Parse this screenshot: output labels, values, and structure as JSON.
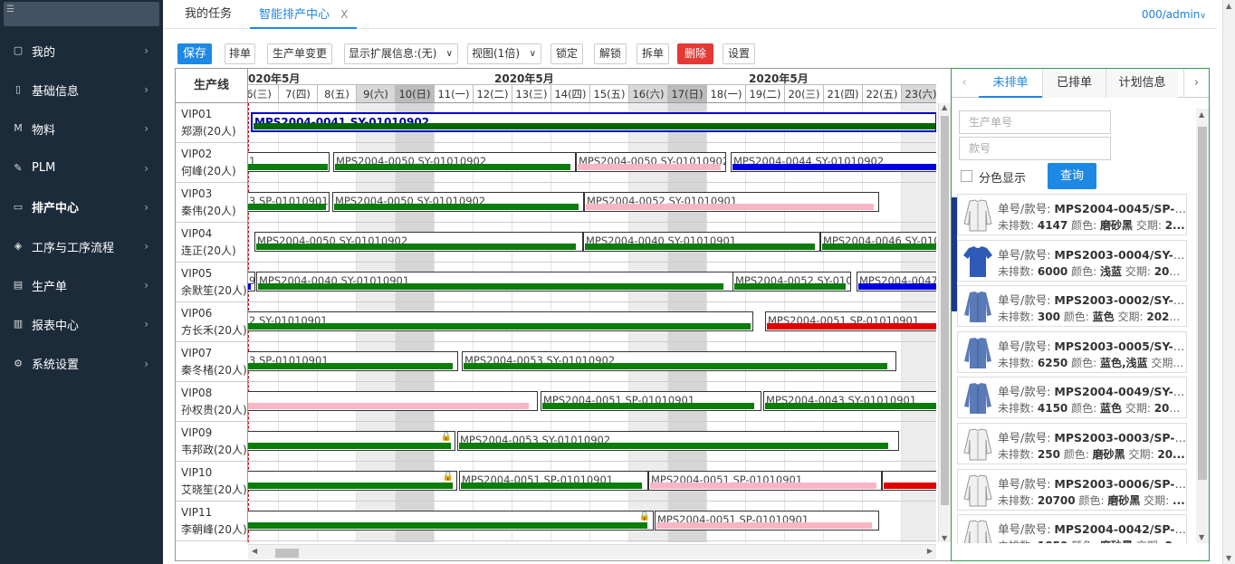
{
  "sidebar": {
    "items": [
      {
        "icon": "home-icon",
        "label": "我的"
      },
      {
        "icon": "document-icon",
        "label": "基础信息"
      },
      {
        "icon": "m-icon",
        "label": "物料"
      },
      {
        "icon": "pen-icon",
        "label": "PLM"
      },
      {
        "icon": "schedule-icon",
        "label": "排产中心"
      },
      {
        "icon": "tag-icon",
        "label": "工序与工序流程"
      },
      {
        "icon": "file-icon",
        "label": "生产单"
      },
      {
        "icon": "chart-icon",
        "label": "报表中心"
      },
      {
        "icon": "gear-icon",
        "label": "系统设置"
      }
    ]
  },
  "header": {
    "tabs": [
      {
        "label": "我的任务"
      },
      {
        "label": "智能排产中心",
        "close": "X"
      }
    ],
    "user": "000/admin"
  },
  "toolbar": {
    "save": "保存",
    "schedule": "排单",
    "change": "生产单变更",
    "ext_info": "显示扩展信息:(无)",
    "view": "视图(1倍)",
    "lock": "锁定",
    "unlock": "解锁",
    "split": "拆单",
    "delete": "删除",
    "settings": "设置"
  },
  "gantt": {
    "line_header": "生产线",
    "months": [
      "020年5月",
      "2020年5月",
      "2020年5月"
    ],
    "days": [
      "6(三)",
      "7(四)",
      "8(五)",
      "9(六)",
      "10(日)",
      "11(一)",
      "12(二)",
      "13(三)",
      "14(四)",
      "15(五)",
      "16(六)",
      "17(日)",
      "18(一)",
      "19(二)",
      "20(三)",
      "21(四)",
      "22(五)",
      "23(六)",
      "2"
    ],
    "lines": [
      {
        "name": "VIP01",
        "people": "郑源(20人)"
      },
      {
        "name": "VIP02",
        "people": "何峰(20人)"
      },
      {
        "name": "VIP03",
        "people": "秦伟(20人)"
      },
      {
        "name": "VIP04",
        "people": "连正(20人)"
      },
      {
        "name": "VIP05",
        "people": "余默笙(20人)"
      },
      {
        "name": "VIP06",
        "people": "方长禾(20人)"
      },
      {
        "name": "VIP07",
        "people": "秦冬楮(20人)"
      },
      {
        "name": "VIP08",
        "people": "孙权贵(20人)"
      },
      {
        "name": "VIP09",
        "people": "韦邦政(20人)"
      },
      {
        "name": "VIP10",
        "people": "艾晓笙(20人)"
      },
      {
        "name": "VIP11",
        "people": "李朝峰(20人)"
      }
    ],
    "tasks": [
      {
        "label": "MPS2004-0041,SY-01010902",
        "color": "#006600"
      },
      {
        "label": "1",
        "color": "#0a7d0a"
      },
      {
        "label": "MPS2004-0050,SY-01010902",
        "color": "#0a7d0a"
      },
      {
        "label": "MPS2004-0050,SY-01010902",
        "color": "#f8b6c4"
      },
      {
        "label": "MPS2004-0044,SY-01010902",
        "color": "#0000e0"
      },
      {
        "label": "3,SP-01010901",
        "color": "#0a7d0a"
      },
      {
        "label": "MPS2004-0050,SY-01010902",
        "color": "#0a7d0a"
      },
      {
        "label": "MPS2004-0052,SY-01010901",
        "color": "#f8b6c4"
      },
      {
        "label": "MPS2004-0050,SY-01010902",
        "color": "#0a7d0a"
      },
      {
        "label": "MPS2004-0040,SY-01010901",
        "color": "#0a7d0a"
      },
      {
        "label": "MPS2004-0046,SY-0101",
        "color": "#0a7d0a"
      },
      {
        "label": "9",
        "color": "#0000e0"
      },
      {
        "label": "MPS2004-0040,SY-01010901",
        "color": "#0a7d0a"
      },
      {
        "label": "MPS2004-0052,SY-010",
        "color": "#0a7d0a"
      },
      {
        "label": "MPS2004-0047",
        "color": "#0000e0"
      },
      {
        "label": "2,SY-01010901",
        "color": "#0a7d0a"
      },
      {
        "label": "MPS2004-0051,SP-01010901",
        "color": "#e00000"
      },
      {
        "label": "3,SP-01010901",
        "color": "#0a7d0a"
      },
      {
        "label": "MPS2004-0053,SY-01010902",
        "color": "#0a7d0a"
      },
      {
        "label": "",
        "color": "#f8b6c4"
      },
      {
        "label": "MPS2004-0051,SP-01010901",
        "color": "#0a7d0a"
      },
      {
        "label": "MPS2004-0043,SY-01010901",
        "color": "#0a7d0a"
      },
      {
        "label": "",
        "color": "#0a7d0a"
      },
      {
        "label": "MPS2004-0053,SY-01010902",
        "color": "#0a7d0a"
      },
      {
        "label": "",
        "color": "#0a7d0a"
      },
      {
        "label": "MPS2004-0051,SP-01010901",
        "color": "#0a7d0a"
      },
      {
        "label": "MPS2004-0051,SP-01010901",
        "color": "#f8b6c4"
      },
      {
        "label": "",
        "color": "#e00000"
      },
      {
        "label": "",
        "color": "#0a7d0a"
      },
      {
        "label": "MPS2004-0051,SP-01010901",
        "color": "#f8b6c4"
      }
    ]
  },
  "panel": {
    "tabs": [
      "未排单",
      "已排单",
      "计划信息"
    ],
    "prev": "‹",
    "next": "›",
    "order_placeholder": "生产单号",
    "style_placeholder": "款号",
    "color_label": "分色显示",
    "query": "查询",
    "cards": [
      {
        "order": "MPS2004-0045/SP-01010901",
        "qty": "4147",
        "color": "磨砂黑",
        "due": "2..."
      },
      {
        "order": "MPS2003-0004/SY-01010902",
        "qty": "6000",
        "color": "浅蓝",
        "due": "202..."
      },
      {
        "order": "MPS2003-0002/SY-01010901",
        "qty": "300",
        "color": "蓝色",
        "due": "2020..."
      },
      {
        "order": "MPS2003-0005/SY-01010901",
        "qty": "6250",
        "color": "蓝色,浅蓝",
        "due": "..."
      },
      {
        "order": "MPS2004-0049/SY-01010901",
        "qty": "4150",
        "color": "蓝色",
        "due": "202..."
      },
      {
        "order": "MPS2003-0003/SP-01010901",
        "qty": "250",
        "color": "磨砂黑",
        "due": "20..."
      },
      {
        "order": "MPS2003-0006/SP-01010901",
        "qty": "20700",
        "color": "磨砂黑",
        "due": "..."
      },
      {
        "order": "MPS2004-0042/SP-01010901",
        "qty": "1850",
        "color": "磨砂黑",
        "due": "2..."
      }
    ],
    "label_order": "单号/款号:",
    "label_qty": "未排数:",
    "label_color": "颜色:",
    "label_due": "交期:"
  },
  "colors": {
    "sidebar_bg": "#1c2b3a",
    "accent": "#1e88e5",
    "delete": "#e53935",
    "active_tab": "#1e88e5"
  }
}
